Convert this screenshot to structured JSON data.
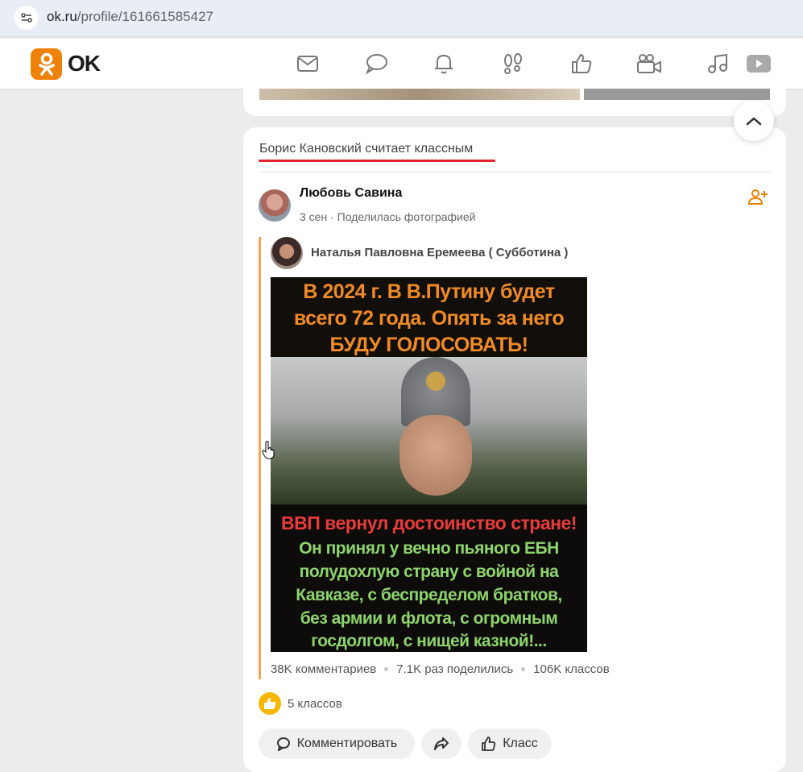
{
  "browser": {
    "url_host": "ok.ru",
    "url_path": "/profile/161661585427"
  },
  "header": {
    "logo_text": "OK",
    "nav_icons": [
      "mail-icon",
      "chat-icon",
      "bell-icon",
      "footprints-icon",
      "thumbs-up-icon",
      "video-camera-icon",
      "music-icon",
      "video-play-icon"
    ]
  },
  "feed": {
    "activity_label": "Борис Кановский считает классным",
    "post": {
      "author_name": "Любовь Савина",
      "time": "3 сен",
      "action": "Поделилась фотографией",
      "repost_author": "Наталья Павловна Еремеева ( Субботина )",
      "image_text_top": [
        "В 2024 г. В В.Путину будет",
        "всего 72 года. Опять за него",
        "БУДУ ГОЛОСОВАТЬ!"
      ],
      "image_text_red": "ВВП вернул достоинство стране!",
      "image_text_bottom": [
        "Он принял  у вечно пьяного ЕБН",
        "полудохлую страну с войной на",
        "Кавказе, с беспределом братков,",
        "без армии и флота, с огромным",
        "госдолгом, с нищей казной!..."
      ],
      "stats": {
        "comments": "38K комментариев",
        "shares": "7.1K раз поделились",
        "classes": "106K классов"
      },
      "likes_label": "5 классов",
      "buttons": {
        "comment": "Комментировать",
        "klass": "Класс"
      }
    }
  },
  "colors": {
    "ok_orange": "#ee8208",
    "activity_underline": "#e3232c",
    "repost_bar": "#f5a55a",
    "like_badge": "#f5b700"
  }
}
